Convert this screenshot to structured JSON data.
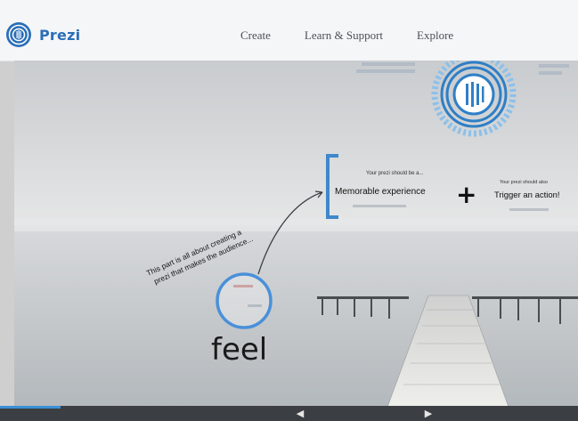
{
  "app": {
    "logo_text": "Prezi",
    "brand_color": "#2a6fb8",
    "accent_color": "#4a90d9"
  },
  "nav": {
    "items": [
      "Create",
      "Learn & Support",
      "Explore"
    ]
  },
  "slide": {
    "bracket_caption": "Your prezi should be a...",
    "memorable": "Memorable experience",
    "plus": "+",
    "action_caption": "Your prezi should also",
    "trigger": "Trigger an action!",
    "diagonal_line1": "This part is all about creating a",
    "diagonal_line2": "prezi that makes the audience...",
    "feel": "feel",
    "icon_name": "prezi-logo-sunburst-icon"
  },
  "controls": {
    "prev_icon": "arrow-left-icon",
    "next_icon": "arrow-right-icon",
    "prev_glyph": "◀",
    "next_glyph": "▶"
  }
}
